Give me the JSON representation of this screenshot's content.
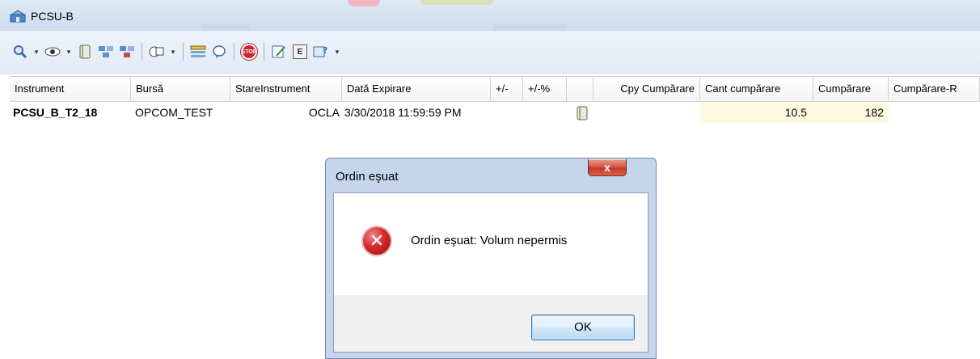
{
  "window": {
    "title": "PCSU-B",
    "toolbar_icons": [
      "zoom-icon",
      "eye-icon",
      "notebook-icon",
      "instrument-add-icon",
      "instrument-remove-icon",
      "order-icon",
      "grid-icon",
      "chat-icon",
      "stop-icon",
      "edit-icon",
      "e-icon",
      "help-icon"
    ],
    "stop_label": "STOP",
    "e_label": "E"
  },
  "grid": {
    "columns": [
      "Instrument",
      "Bursă",
      "StareInstrument",
      "Dată Expirare",
      "+/-",
      "+/-%",
      "",
      "Cpy Cumpărare",
      "Cant cumpărare",
      "Cumpărare",
      "Cumpărare-R"
    ],
    "row": {
      "instrument": "PCSU_B_T2_18",
      "bursa": "OPCOM_TEST",
      "stare": "OCLA",
      "data_expirare": "3/30/2018 11:59:59 PM",
      "cant_cumparare": "10.5",
      "cumparare": "182"
    },
    "highlight_color": "#fefae0"
  },
  "dialog": {
    "title": "Ordin eşuat",
    "close_label": "x",
    "message": "Ordin eşuat: Volum nepermis",
    "ok_label": "OK",
    "error_icon_glyph": "✕"
  }
}
